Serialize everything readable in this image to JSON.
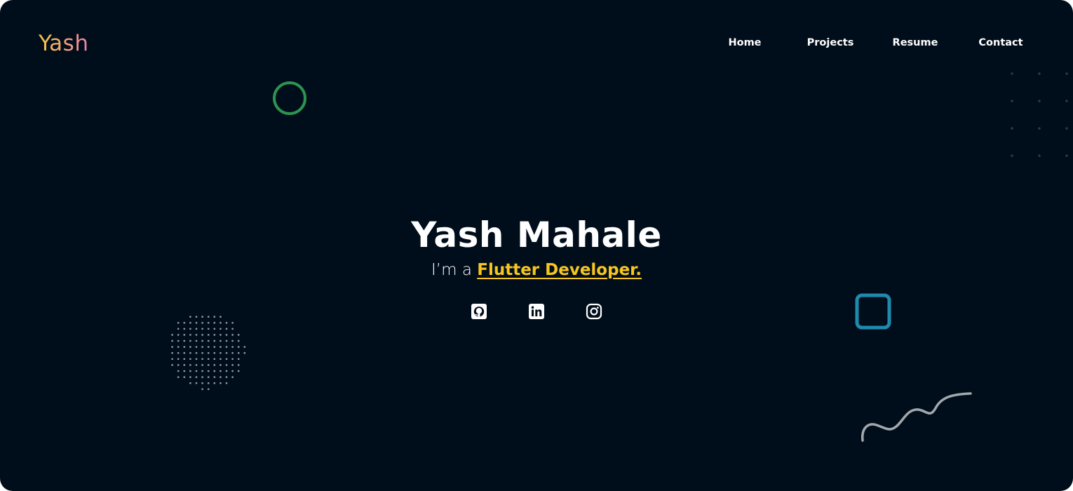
{
  "brand": {
    "logo_text": "Yash"
  },
  "nav": {
    "items": [
      {
        "label": "Home"
      },
      {
        "label": "Projects"
      },
      {
        "label": "Resume"
      },
      {
        "label": "Contact"
      }
    ]
  },
  "hero": {
    "name": "Yash Mahale",
    "intro_prefix": "I’m a",
    "role": "Flutter Developer."
  },
  "social": {
    "icons": [
      "github-icon",
      "linkedin-icon",
      "instagram-icon"
    ]
  },
  "colors": {
    "background": "#000e1c",
    "accent_yellow": "#f7c51e",
    "logo_gradient_start": "#f7c646",
    "logo_gradient_end": "#ef80a8",
    "decor_circle": "#2e9350",
    "decor_square": "#1f8aac",
    "decor_squiggle": "#a3a8ad"
  }
}
